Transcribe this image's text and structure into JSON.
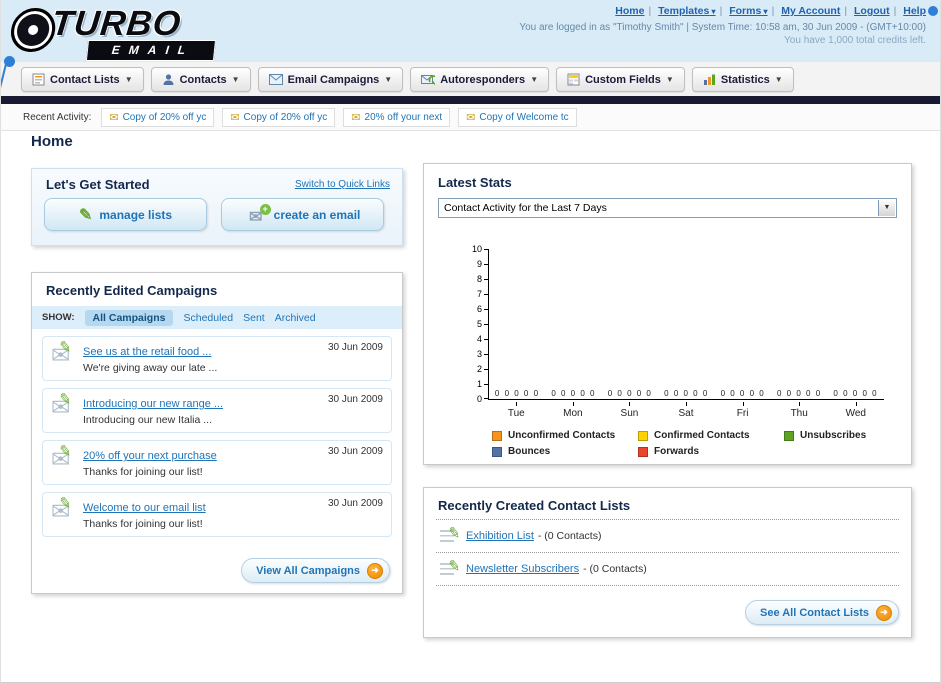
{
  "header": {
    "logo_top": "TURBO",
    "logo_bottom": "EMAIL",
    "nav_links": [
      {
        "label": "Home",
        "dropdown": false
      },
      {
        "label": "Templates",
        "dropdown": true
      },
      {
        "label": "Forms",
        "dropdown": true
      },
      {
        "label": "My Account",
        "dropdown": false
      },
      {
        "label": "Logout",
        "dropdown": false
      },
      {
        "label": "Help",
        "dropdown": false
      }
    ],
    "login_info": "You are logged in as \"Timothy Smith\" | System Time: 10:58 am, 30 Jun 2009 - (GMT+10:00)",
    "credits_info": "You have 1,000 total credits left."
  },
  "nav_tabs": [
    {
      "label": "Contact Lists"
    },
    {
      "label": "Contacts"
    },
    {
      "label": "Email Campaigns"
    },
    {
      "label": "Autoresponders"
    },
    {
      "label": "Custom Fields"
    },
    {
      "label": "Statistics"
    }
  ],
  "recent_activity": {
    "label": "Recent Activity:",
    "items": [
      {
        "text": "Copy of 20% off yc"
      },
      {
        "text": "Copy of 20% off yc"
      },
      {
        "text": "20% off your next"
      },
      {
        "text": "Copy of Welcome tc"
      }
    ]
  },
  "page_title": "Home",
  "get_started": {
    "title": "Let's Get Started",
    "switch_link": "Switch to Quick Links",
    "manage_lists_label": "manage lists",
    "create_email_label": "create an email"
  },
  "campaigns": {
    "title": "Recently Edited Campaigns",
    "show_label": "SHOW:",
    "filters": [
      "All Campaigns",
      "Scheduled",
      "Sent",
      "Archived"
    ],
    "active_filter": "All Campaigns",
    "items": [
      {
        "title": "See us at the retail food ...",
        "subtitle": "We're giving away our late ...",
        "date": "30 Jun 2009"
      },
      {
        "title": "Introducing our new range ...",
        "subtitle": "Introducing our new Italia ...",
        "date": "30 Jun 2009"
      },
      {
        "title": "20% off your next purchase",
        "subtitle": "Thanks for joining our list!",
        "date": "30 Jun 2009"
      },
      {
        "title": "Welcome to our email list",
        "subtitle": "Thanks for joining our list!",
        "date": "30 Jun 2009"
      }
    ],
    "view_all_label": "View All Campaigns"
  },
  "stats": {
    "title": "Latest Stats",
    "dropdown_value": "Contact Activity for the Last 7 Days",
    "chart_data": {
      "type": "bar",
      "categories": [
        "Tue",
        "Mon",
        "Sun",
        "Sat",
        "Fri",
        "Thu",
        "Wed"
      ],
      "series": [
        {
          "name": "Unconfirmed Contacts",
          "color": "#f7941d",
          "values": [
            0,
            0,
            0,
            0,
            0,
            0,
            0
          ]
        },
        {
          "name": "Confirmed Contacts",
          "color": "#ffd200",
          "values": [
            0,
            0,
            0,
            0,
            0,
            0,
            0
          ]
        },
        {
          "name": "Unsubscribes",
          "color": "#5da423",
          "values": [
            0,
            0,
            0,
            0,
            0,
            0,
            0
          ]
        },
        {
          "name": "Bounces",
          "color": "#5572a7",
          "values": [
            0,
            0,
            0,
            0,
            0,
            0,
            0
          ]
        },
        {
          "name": "Forwards",
          "color": "#e8472b",
          "values": [
            0,
            0,
            0,
            0,
            0,
            0,
            0
          ]
        }
      ],
      "title": "Contact Activity for the Last 7 Days",
      "xlabel": "",
      "ylabel": "",
      "ylim": [
        0,
        10
      ],
      "yticks": [
        0,
        1,
        2,
        3,
        4,
        5,
        6,
        7,
        8,
        9,
        10
      ],
      "grid": false,
      "legend_position": "bottom"
    }
  },
  "contact_lists": {
    "title": "Recently Created Contact Lists",
    "items": [
      {
        "name": "Exhibition List",
        "detail": "- (0 Contacts)"
      },
      {
        "name": "Newsletter Subscribers",
        "detail": "- (0 Contacts)"
      }
    ],
    "see_all_label": "See All Contact Lists"
  }
}
